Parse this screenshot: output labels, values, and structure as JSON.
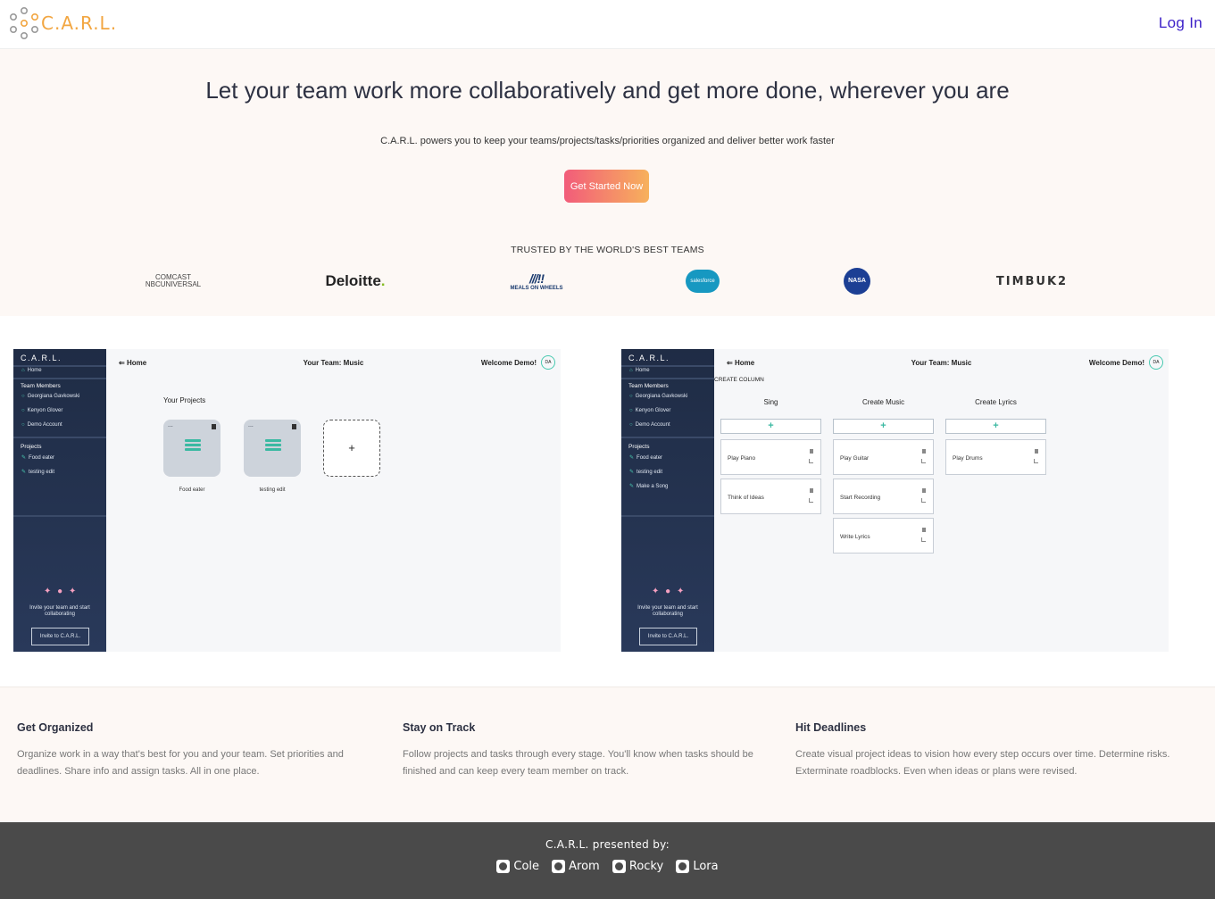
{
  "nav": {
    "brand": "C.A.R.L.",
    "login": "Log In"
  },
  "hero": {
    "headline": "Let your team work more collaboratively and get more done, wherever you are",
    "subtitle": "C.A.R.L. powers you to keep your teams/projects/tasks/priorities organized and deliver better work faster",
    "cta": "Get Started Now",
    "trusted": "TRUSTED BY THE WORLD'S BEST TEAMS"
  },
  "logos": {
    "comcast_1": "COMCAST",
    "comcast_2": "NBCUNIVERSAL",
    "deloitte": "Deloitte",
    "deloitte_dot": ".",
    "meals_mark": "///!!",
    "meals": "MEALS ON WHEELS",
    "salesforce": "salesforce",
    "nasa": "NASA",
    "timbuk2": "TIMBUK2"
  },
  "shot_common": {
    "brand": "C.A.R.L.",
    "home": "Home",
    "team_members": "Team Members",
    "members": [
      "Georgiana Gavkowski",
      "Kenyon Glover",
      "Demo Account"
    ],
    "projects": "Projects",
    "invite_text": "Invite your team and start collaborating",
    "invite_btn": "Invite to C.A.R.L.",
    "back": "Home",
    "team": "Your Team: Music",
    "welcome": "Welcome Demo!",
    "avatar": "DA"
  },
  "shot1": {
    "projects": [
      "Food eater",
      "testing edit"
    ],
    "your_projects": "Your Projects",
    "dots": "...",
    "add": "+"
  },
  "shot2": {
    "projects": [
      "Food eater",
      "testing edit",
      "Make a Song"
    ],
    "create_column": "CREATE COLUMN",
    "add": "+",
    "columns": [
      {
        "title": "Sing",
        "cards": [
          "Play Piano",
          "Think of Ideas"
        ]
      },
      {
        "title": "Create Music",
        "cards": [
          "Play Guitar",
          "Start Recording",
          "Write Lyrics"
        ]
      },
      {
        "title": "Create Lyrics",
        "cards": [
          "Play Drums"
        ]
      }
    ]
  },
  "features": [
    {
      "title": "Get Organized",
      "text": "Organize work in a way that's best for you and your team. Set priorities and deadlines. Share info and assign tasks. All in one place."
    },
    {
      "title": "Stay on Track",
      "text": "Follow projects and tasks through every stage. You'll know when tasks should be finished and can keep every team member on track."
    },
    {
      "title": "Hit Deadlines",
      "text": "Create visual project ideas to vision how every step occurs over time. Determine risks. Exterminate roadblocks. Even when ideas or plans were revised."
    }
  ],
  "footer": {
    "title": "C.A.R.L. presented by:",
    "authors": [
      "Cole",
      "Arom",
      "Rocky",
      "Lora"
    ]
  },
  "icons": {
    "github": "github-icon",
    "brand": "molecule-logo-icon"
  },
  "colors": {
    "accent": "#3b1fc8",
    "brand": "#f2a641",
    "teal": "#3bb9a2"
  }
}
